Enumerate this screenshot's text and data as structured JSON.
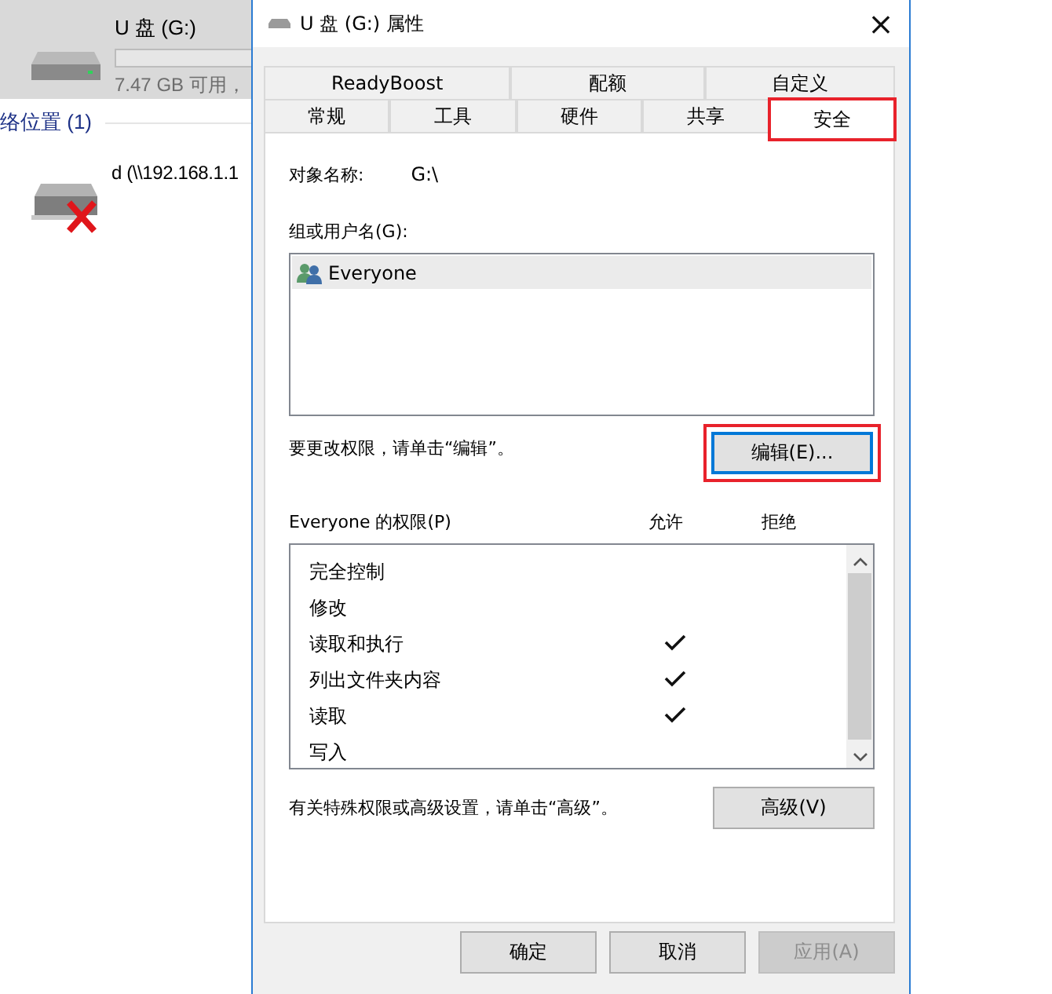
{
  "explorer": {
    "drive": {
      "name": "U 盘 (G:)",
      "free": "7.47 GB 可用，",
      "selected": true
    },
    "section": "络位置 (1)",
    "network_drive": {
      "name": "d (\\\\192.168.1.1",
      "disconnected": true
    }
  },
  "window": {
    "title": "U 盘 (G:) 属性",
    "close": "×"
  },
  "tabs_top": [
    {
      "label": "ReadyBoost",
      "selected": false
    },
    {
      "label": "配额",
      "selected": false
    },
    {
      "label": "自定义",
      "selected": false
    }
  ],
  "tabs": [
    {
      "label": "常规",
      "selected": false,
      "highlighted": false
    },
    {
      "label": "工具",
      "selected": false,
      "highlighted": false
    },
    {
      "label": "硬件",
      "selected": false,
      "highlighted": false
    },
    {
      "label": "共享",
      "selected": false,
      "highlighted": false
    },
    {
      "label": "安全",
      "selected": true,
      "highlighted": true
    }
  ],
  "object_label": "对象名称:",
  "object_value": "G:\\",
  "groups_label": "组或用户名(G):",
  "groups": [
    {
      "name": "Everyone",
      "selected": true
    }
  ],
  "edit_hint": "要更改权限，请单击“编辑”。",
  "edit_button": {
    "label": "编辑(E)...",
    "highlighted": true,
    "focused": true
  },
  "permissions_label": "Everyone 的权限(P)",
  "allow_header": "允许",
  "deny_header": "拒绝",
  "permissions": [
    {
      "name": "完全控制",
      "allow": false,
      "deny": false
    },
    {
      "name": "修改",
      "allow": false,
      "deny": false
    },
    {
      "name": "读取和执行",
      "allow": true,
      "deny": false
    },
    {
      "name": "列出文件夹内容",
      "allow": true,
      "deny": false
    },
    {
      "name": "读取",
      "allow": true,
      "deny": false
    },
    {
      "name": "写入",
      "allow": false,
      "deny": false
    }
  ],
  "advanced_hint": "有关特殊权限或高级设置，请单击“高级”。",
  "advanced_button": "高级(V)",
  "buttons": [
    {
      "label": "确定",
      "disabled": false
    },
    {
      "label": "取消",
      "disabled": false
    },
    {
      "label": "应用(A)",
      "disabled": true
    }
  ]
}
